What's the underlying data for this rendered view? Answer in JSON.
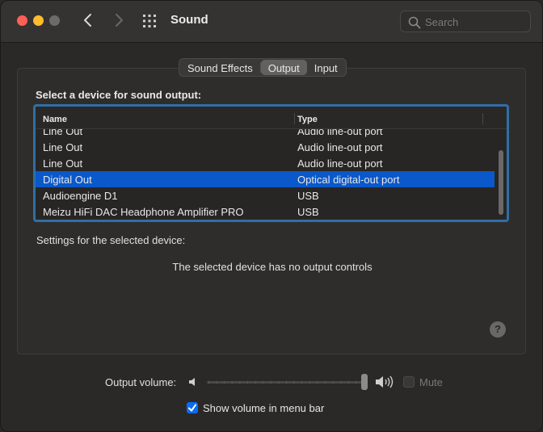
{
  "window": {
    "title": "Sound",
    "search_placeholder": "Search"
  },
  "tabs": [
    {
      "label": "Sound Effects",
      "active": false
    },
    {
      "label": "Output",
      "active": true
    },
    {
      "label": "Input",
      "active": false
    }
  ],
  "output": {
    "section_label": "Select a device for sound output:",
    "columns": {
      "name": "Name",
      "type": "Type"
    },
    "devices": [
      {
        "name": "Line Out",
        "type": "Audio line-out port",
        "selected": false
      },
      {
        "name": "Line Out",
        "type": "Audio line-out port",
        "selected": false
      },
      {
        "name": "Line Out",
        "type": "Audio line-out port",
        "selected": false
      },
      {
        "name": "Digital Out",
        "type": "Optical digital-out port",
        "selected": true
      },
      {
        "name": "Audioengine D1",
        "type": "USB",
        "selected": false
      },
      {
        "name": "Meizu HiFi DAC Headphone Amplifier PRO",
        "type": "USB",
        "selected": false
      }
    ],
    "settings_label": "Settings for the selected device:",
    "no_controls_message": "The selected device has no output controls",
    "help_label": "?"
  },
  "volume": {
    "label": "Output volume:",
    "level": 1.0,
    "mute_label": "Mute",
    "muted": false,
    "show_in_menu_bar_label": "Show volume in menu bar",
    "show_in_menu_bar": true
  },
  "colors": {
    "accent": "#0a58ca",
    "focus_ring": "#2f6ea6",
    "close": "#fe5f57",
    "minimize": "#febc2e"
  }
}
